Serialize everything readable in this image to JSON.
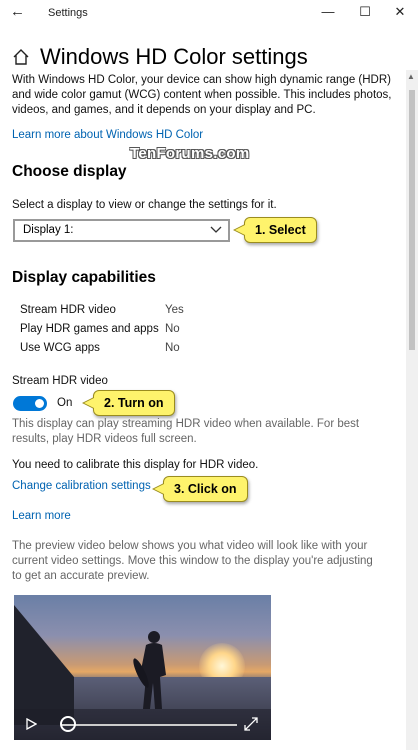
{
  "window": {
    "title": "Settings",
    "back_glyph": "←",
    "minimize_glyph": "—",
    "maximize_glyph": "☐",
    "close_glyph": "✕"
  },
  "page": {
    "title": "Windows HD Color settings",
    "intro": "With Windows HD Color, your device can show high dynamic range (HDR) and wide color gamut (WCG) content when possible. This includes photos, videos, and games, and it depends on your display and PC.",
    "learn_more_hd": "Learn more about Windows HD Color"
  },
  "watermark": "TenForums.com",
  "choose_display": {
    "heading": "Choose display",
    "label": "Select a display to view or change the settings for it.",
    "selected": "Display 1:"
  },
  "capabilities": {
    "heading": "Display capabilities",
    "rows": [
      {
        "name": "Stream HDR video",
        "value": "Yes"
      },
      {
        "name": "Play HDR games and apps",
        "value": "No"
      },
      {
        "name": "Use WCG apps",
        "value": "No"
      }
    ]
  },
  "stream_hdr": {
    "label": "Stream HDR video",
    "state": "On",
    "enabled": true,
    "description": "This display can play streaming HDR video when available. For best results, play HDR videos full screen."
  },
  "calibration": {
    "notice": "You need to calibrate this display for HDR video.",
    "link": "Change calibration settings",
    "learn_more": "Learn more"
  },
  "preview": {
    "description": "The preview video below shows you what video will look like with your current video settings. Move this window to the display you're adjusting to get an accurate preview.",
    "progress": 0.0
  },
  "callouts": {
    "select": "1. Select",
    "turn_on": "2. Turn on",
    "click_on": "3. Click on"
  },
  "colors": {
    "accent": "#0078d7",
    "link": "#0063b1",
    "callout": "#fef36c"
  }
}
